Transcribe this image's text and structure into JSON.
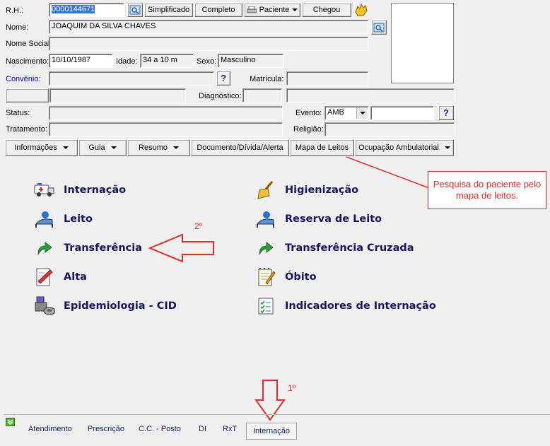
{
  "header": {
    "rh_label": "R.H.:",
    "rh_value": "0000144671",
    "btn_simplificado": "Simplificado",
    "btn_completo": "Completo",
    "btn_paciente": "Paciente",
    "btn_chegou": "Chegou",
    "nome_label": "Nome:",
    "nome_value": "JOAQUIM DA SILVA CHAVES",
    "nome_social_label": "Nome Social:",
    "nascimento_label": "Nascimento:",
    "nascimento_value": "10/10/1987",
    "idade_label": "Idade:",
    "idade_value": "34 a 10 m",
    "sexo_label": "Sexo:",
    "sexo_value": "Masculino",
    "convenio_label": "Convênio:",
    "matricula_label": "Matrícula:",
    "diagnostico_label": "Diagnóstico:",
    "status_label": "Status:",
    "evento_label": "Evento:",
    "evento_value": "AMB",
    "tratamento_label": "Tratamento:",
    "religiao_label": "Religião:",
    "help_glyph": "?"
  },
  "toolbar": [
    {
      "label": "Informações",
      "dropdown": true
    },
    {
      "label": "Guia",
      "dropdown": true
    },
    {
      "label": "Resumo",
      "dropdown": true
    },
    {
      "label": "Documento/Dívida/Alerta",
      "dropdown": false
    },
    {
      "label": "Mapa de Leitos",
      "dropdown": false
    },
    {
      "label": "Ocupação Ambulatorial",
      "dropdown": true
    }
  ],
  "menu_left": [
    {
      "label": "Internação",
      "icon": "ambulance-icon"
    },
    {
      "label": "Leito",
      "icon": "bed-icon"
    },
    {
      "label": "Transferência",
      "icon": "arrow-forward-icon"
    },
    {
      "label": "Alta",
      "icon": "discharge-document-icon"
    },
    {
      "label": "Epidemiologia - CID",
      "icon": "epidemiology-icon"
    }
  ],
  "menu_right": [
    {
      "label": "Higienização",
      "icon": "broom-icon"
    },
    {
      "label": "Reserva de Leito",
      "icon": "bed-icon"
    },
    {
      "label": "Transferência Cruzada",
      "icon": "arrow-forward-icon"
    },
    {
      "label": "Óbito",
      "icon": "notepad-icon"
    },
    {
      "label": "Indicadores de Internação",
      "icon": "checklist-icon"
    }
  ],
  "annotations": {
    "note": "Pesquisa do paciente pelo mapa de leitos.",
    "step1": "1º",
    "step2": "2º"
  },
  "tabs": [
    {
      "label": "Atendimento",
      "active": false
    },
    {
      "label": "Prescrição",
      "active": false
    },
    {
      "label": "C.C. - Posto",
      "active": false
    },
    {
      "label": "DI",
      "active": false
    },
    {
      "label": "RxT",
      "active": false
    },
    {
      "label": "Internação",
      "active": true
    }
  ],
  "colors": {
    "accent_red": "#e52b2b",
    "menu_text": "#16165e",
    "selection": "#3a74d8"
  }
}
